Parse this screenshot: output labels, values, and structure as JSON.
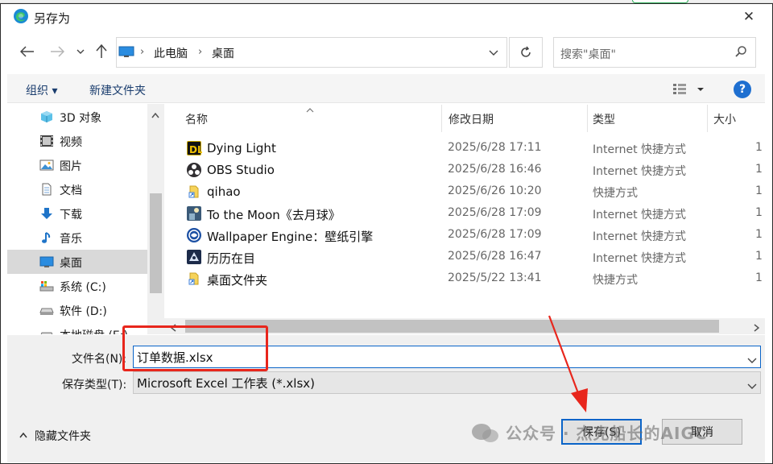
{
  "dialog": {
    "title": "另存为",
    "close_label": "✕"
  },
  "address": {
    "crumb_1": "此电脑",
    "crumb_2": "桌面"
  },
  "search": {
    "placeholder": "搜索\"桌面\""
  },
  "toolbar": {
    "organize": "组织 ▾",
    "new_folder": "新建文件夹",
    "help": "?"
  },
  "nav": {
    "items": [
      {
        "label": "3D 对象",
        "icon": "3d-objects-icon"
      },
      {
        "label": "视频",
        "icon": "videos-icon"
      },
      {
        "label": "图片",
        "icon": "pictures-icon"
      },
      {
        "label": "文档",
        "icon": "documents-icon"
      },
      {
        "label": "下载",
        "icon": "downloads-icon"
      },
      {
        "label": "音乐",
        "icon": "music-icon"
      },
      {
        "label": "桌面",
        "icon": "desktop-icon"
      },
      {
        "label": "系统 (C:)",
        "icon": "system-drive-icon"
      },
      {
        "label": "软件 (D:)",
        "icon": "drive-icon"
      },
      {
        "label": "本地磁盘 (E:)",
        "icon": "drive-icon"
      }
    ],
    "selected_index": 6
  },
  "columns": {
    "name": "名称",
    "date": "修改日期",
    "type": "类型",
    "size": "大小"
  },
  "files": [
    {
      "name": "Dying Light",
      "date": "2025/6/28 17:11",
      "type": "Internet 快捷方式",
      "size": "1"
    },
    {
      "name": "OBS Studio",
      "date": "2025/6/28 16:46",
      "type": "Internet 快捷方式",
      "size": "1"
    },
    {
      "name": "qihao",
      "date": "2025/6/26 10:20",
      "type": "快捷方式",
      "size": "1"
    },
    {
      "name": "To the Moon《去月球》",
      "date": "2025/6/28 17:09",
      "type": "Internet 快捷方式",
      "size": "1"
    },
    {
      "name": "Wallpaper Engine：壁纸引擎",
      "date": "2025/6/28 17:09",
      "type": "Internet 快捷方式",
      "size": "1"
    },
    {
      "name": "历历在目",
      "date": "2025/6/28 16:47",
      "type": "Internet 快捷方式",
      "size": "1"
    },
    {
      "name": "桌面文件夹",
      "date": "2025/5/22 13:41",
      "type": "快捷方式",
      "size": "1"
    }
  ],
  "form": {
    "filename_label": "文件名(N):",
    "filename_value": "订单数据.xlsx",
    "filetype_label": "保存类型(T):",
    "filetype_value": "Microsoft Excel 工作表 (*.xlsx)"
  },
  "footer": {
    "hide_folders": "隐藏文件夹",
    "save": "保存(S)",
    "cancel": "取消"
  },
  "watermark": "公众号 · 杰克船长的AIGC",
  "colors": {
    "accent": "#0a64c8",
    "highlight_box": "#e8261c",
    "arrow": "#e8261c",
    "help_icon": "#1e6fd0"
  }
}
